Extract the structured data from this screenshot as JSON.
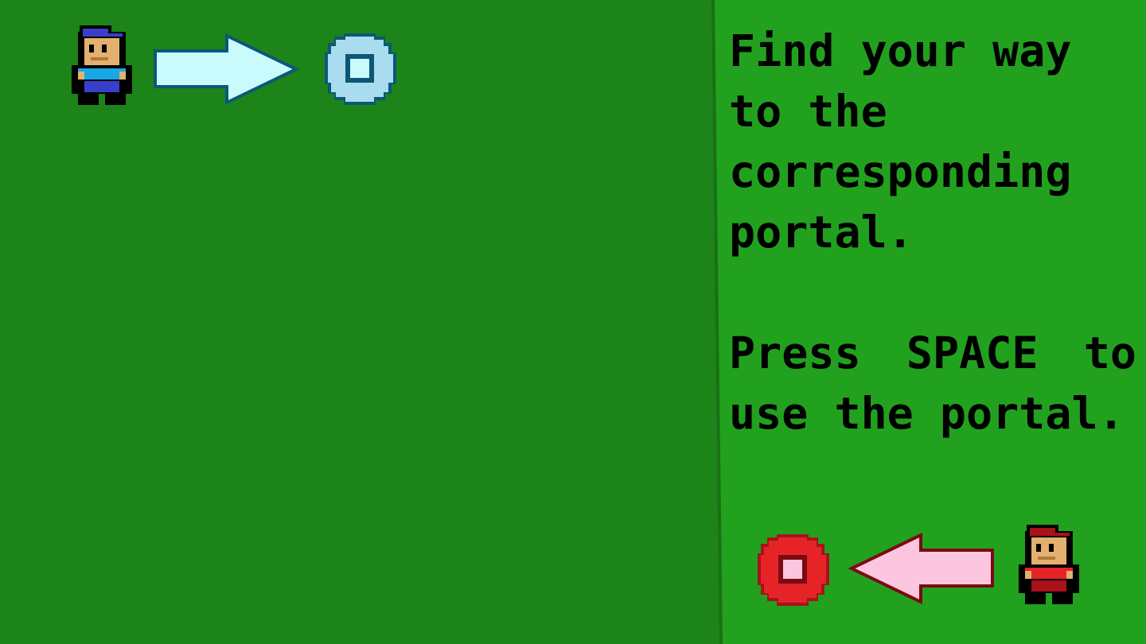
{
  "instructions": {
    "line1": "Find your way",
    "line2": "to the",
    "line3": "corresponding",
    "line4": "portal.",
    "line5_word1": "Press",
    "line5_word2": "SPACE",
    "line5_word3": "to",
    "line6": "use the portal."
  },
  "colors": {
    "field_dark": "#1c8418",
    "field_light": "#22a11f",
    "blue_portal": "#a9dcef",
    "blue_arrow": "#c9fbfd",
    "red_portal": "#e62428",
    "red_arrow": "#fcc5e0"
  },
  "icons": {
    "blue_player": "blue-player-sprite",
    "blue_arrow": "right-arrow-icon",
    "blue_portal": "blue-portal-icon",
    "red_player": "red-player-sprite",
    "red_arrow": "left-arrow-icon",
    "red_portal": "red-portal-icon"
  }
}
